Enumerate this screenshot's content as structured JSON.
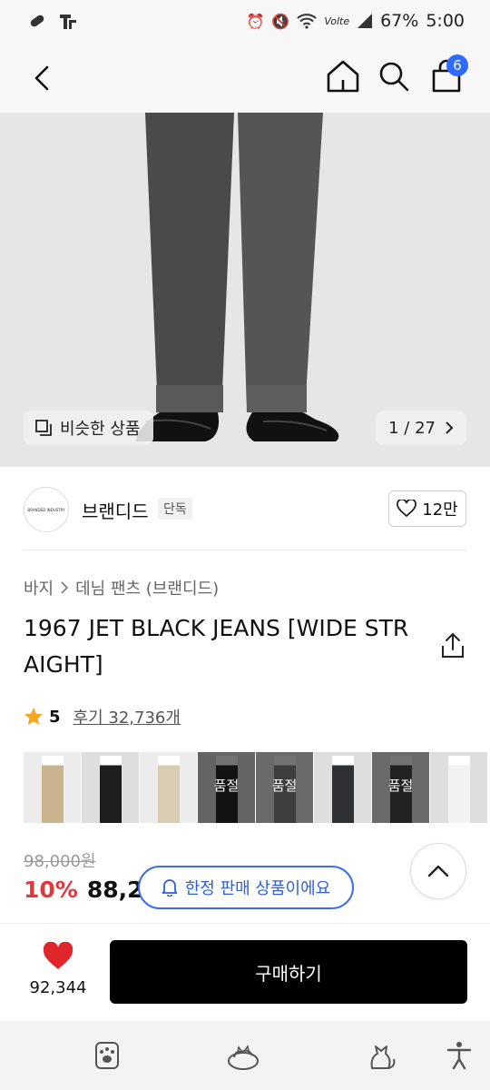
{
  "status": {
    "time": "5:00",
    "battery": "67%",
    "network": "Volte"
  },
  "header": {
    "cart_count": "6"
  },
  "gallery": {
    "similar_label": "비슷한 상품",
    "counter": "1 / 27"
  },
  "brand": {
    "logo_text": "BRANDED INDUSTRY",
    "name": "브랜디드",
    "tag": "단독",
    "likes": "12만"
  },
  "breadcrumb": {
    "level1": "바지",
    "level2": "데님 팬츠 (브랜디드)"
  },
  "product": {
    "title": "1967 JET BLACK JEANS [WIDE STRAIGHT]"
  },
  "rating": {
    "score": "5",
    "reviews_label": "후기 32,736개"
  },
  "thumbnails": [
    {
      "color": "#c9b48e",
      "soldout": ""
    },
    {
      "color": "#1e1e1e",
      "soldout": ""
    },
    {
      "color": "#d8ccb2",
      "soldout": ""
    },
    {
      "color": "#2a2a2a",
      "soldout": "품절"
    },
    {
      "color": "#8a8a8a",
      "soldout": "품절"
    },
    {
      "color": "#2e3033",
      "soldout": ""
    },
    {
      "color": "#4d4d4d",
      "soldout": "품절"
    },
    {
      "color": "#f2f2f2",
      "soldout": ""
    }
  ],
  "price": {
    "original": "98,000원",
    "discount": "10%",
    "current": "88,2",
    "limited_label": "한정 판매 상품이에요"
  },
  "bottom": {
    "wish_count": "92,344",
    "buy_label": "구매하기"
  },
  "colors": {
    "accent_blue": "#2f6bff",
    "discount_red": "#e0393e",
    "heart_red": "#e0262b",
    "star": "#f5a623"
  }
}
